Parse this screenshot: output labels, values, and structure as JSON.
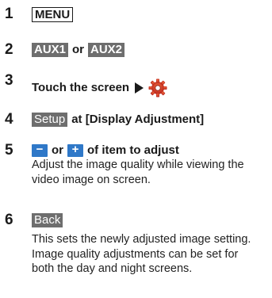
{
  "steps": [
    {
      "number": "1",
      "key": "MENU"
    },
    {
      "number": "2",
      "key_a": "AUX1",
      "connector": "or",
      "key_b": "AUX2"
    },
    {
      "number": "3",
      "text": "Touch the screen",
      "arrow_icon": "right-triangle-arrow-icon",
      "gear_icon": "settings-gear-icon"
    },
    {
      "number": "4",
      "key": "Setup",
      "text": "at [Display Adjustment]"
    },
    {
      "number": "5",
      "minus": "−",
      "connector": "or",
      "plus": "+",
      "text": "of item to adjust",
      "description": "Adjust the image quality while viewing the video image on screen."
    },
    {
      "number": "6",
      "key": "Back",
      "description": "This sets the newly adjusted image setting. Image quality adjustments can be set for both the day and night screens."
    }
  ],
  "colors": {
    "key_fill": "#6e6e6e",
    "button_blue": "#2f78c8",
    "gear_red": "#d8332a"
  }
}
